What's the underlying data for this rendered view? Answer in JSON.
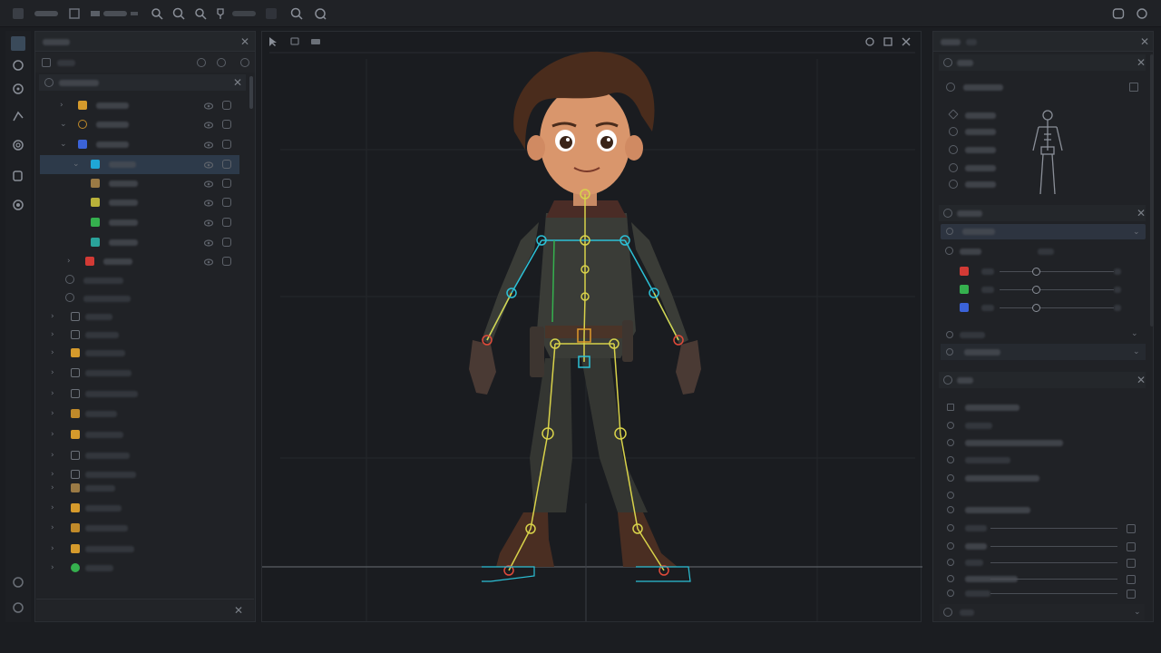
{
  "app": {
    "window_title": ""
  },
  "toolbar": {
    "icons": [
      "app-menu-icon",
      "layout-icon",
      "capture-icon",
      "grid-icon",
      "magnify-icon",
      "zoom-in-icon",
      "zoom-out-icon",
      "pin-icon",
      "link-icon",
      "bookmark-icon",
      "search-icon",
      "refresh-icon",
      "chat-icon",
      "expand-icon"
    ]
  },
  "left_panel": {
    "title": "",
    "hierarchy_title": "",
    "rows": [
      {
        "color": "#d59a2c",
        "selected": false
      },
      {
        "color": "#c08a2a",
        "selected": false
      },
      {
        "color": "#3b63d8",
        "selected": false
      },
      {
        "color": "#1fa6d6",
        "selected": true
      },
      {
        "color": "#9a7a45",
        "selected": false
      },
      {
        "color": "#b9b23a",
        "selected": false
      },
      {
        "color": "#35b04e",
        "selected": false
      },
      {
        "color": "#2aa39a",
        "selected": false
      },
      {
        "color": "#d23a35",
        "selected": false
      }
    ],
    "asset_rows": [
      {
        "color": "#6b7078"
      },
      {
        "color": "#6b7078"
      },
      {
        "color": "#d59a2c"
      },
      {
        "color": "#6b7078"
      },
      {
        "color": "#6b7078"
      },
      {
        "color": "#c08a2a"
      },
      {
        "color": "#d59a2c"
      },
      {
        "color": "#6b7078"
      },
      {
        "color": "#6b7078"
      },
      {
        "color": "#9a7a45"
      },
      {
        "color": "#d59a2c"
      },
      {
        "color": "#c08a2a"
      },
      {
        "color": "#d59a2c"
      },
      {
        "color": "#35b04e"
      }
    ]
  },
  "viewport": {
    "title": "",
    "character": "cartoon boy rigged with skeleton"
  },
  "right_panel": {
    "title": "",
    "channels": [
      {
        "color": "#d23a35",
        "value": 0.5
      },
      {
        "color": "#35b04e",
        "value": 0.5
      },
      {
        "color": "#3b63d8",
        "value": 0.5
      }
    ]
  }
}
